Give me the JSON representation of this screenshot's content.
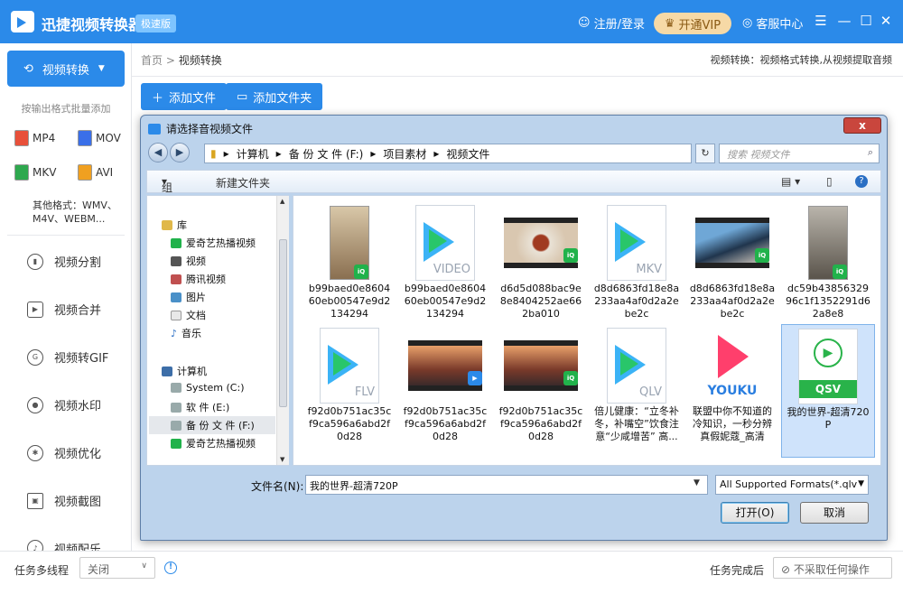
{
  "app": {
    "title": "迅捷视频转换器",
    "edition": "极速版",
    "login": "注册/登录",
    "vip": "开通VIP",
    "service": "客服中心",
    "menu_icon": "☰",
    "min_icon": "—",
    "max_icon": "☐",
    "close_icon": "✕"
  },
  "sidebar": {
    "active": "视频转换",
    "hint": "按输出格式批量添加",
    "formats": [
      "MP4",
      "MOV",
      "MKV",
      "AVI"
    ],
    "other": "其他格式：WMV、M4V、WEBM...",
    "items": [
      {
        "label": "视频分割",
        "icon": "split-icon"
      },
      {
        "label": "视频合并",
        "icon": "merge-icon"
      },
      {
        "label": "视频转GIF",
        "icon": "gif-icon"
      },
      {
        "label": "视频水印",
        "icon": "watermark-icon"
      },
      {
        "label": "视频优化",
        "icon": "optimize-icon"
      },
      {
        "label": "视频截图",
        "icon": "screenshot-icon"
      },
      {
        "label": "视频配乐",
        "icon": "music-icon"
      }
    ]
  },
  "main": {
    "breadcrumb_home": "首页",
    "breadcrumb_sep": ">",
    "breadcrumb_current": "视频转换",
    "hint": "视频转换：视频格式转换,从视频提取音频",
    "add_file": "添加文件",
    "add_folder": "添加文件夹"
  },
  "status": {
    "multithread_label": "任务多线程",
    "multithread_value": "关闭",
    "after_label": "任务完成后",
    "after_value": "不采取任何操作"
  },
  "dialog": {
    "title": "请选择音视频文件",
    "close": "x",
    "path": [
      "计算机",
      "备 份 文 件 (F:)",
      "项目素材",
      "视频文件"
    ],
    "search_placeholder": "搜索 视频文件",
    "organize": "组织",
    "new_folder": "新建文件夹",
    "tree": {
      "library": "库",
      "lib_items": [
        "爱奇艺热播视频",
        "视频",
        "腾讯视频",
        "图片",
        "文档",
        "音乐"
      ],
      "computer": "计算机",
      "drives": [
        "System (C:)",
        "软 件 (E:)",
        "备 份 文 件 (F:)",
        "爱奇艺热播视频"
      ]
    },
    "files": [
      {
        "name": "b99baed0e860460eb00547e9d2134294",
        "kind": "phone-video"
      },
      {
        "name": "b99baed0e860460eb00547e9d2134294",
        "kind": "doc",
        "ext": "VIDEO"
      },
      {
        "name": "d6d5d088bac9e8e8404252ae662ba010",
        "kind": "film"
      },
      {
        "name": "d8d6863fd18e8a233aa4af0d2a2ebe2c",
        "kind": "doc",
        "ext": "MKV"
      },
      {
        "name": "d8d6863fd18e8a233aa4af0d2a2ebe2c",
        "kind": "film"
      },
      {
        "name": "dc59b4385632996c1f1352291d62a8e8",
        "kind": "phone-video"
      },
      {
        "name": "f92d0b751ac35cf9ca596a6abd2f0d28",
        "kind": "doc",
        "ext": "FLV"
      },
      {
        "name": "f92d0b751ac35cf9ca596a6abd2f0d28",
        "kind": "film"
      },
      {
        "name": "f92d0b751ac35cf9ca596a6abd2f0d28",
        "kind": "film"
      },
      {
        "name": "倍儿健康：“立冬补冬，补嘴空”饮食注意“少咸增苦” 高...",
        "kind": "doc",
        "ext": "QLV"
      },
      {
        "name": "联盟中你不知道的冷知识，一秒分辨真假妮蔻_高清",
        "kind": "youku",
        "ext": "YOUKU"
      },
      {
        "name": "我的世界-超清720P",
        "kind": "qsv",
        "ext": "QSV",
        "selected": true
      }
    ],
    "filename_label": "文件名(N):",
    "filename_value": "我的世界-超清720P",
    "format_value": "All Supported Formats(*.qlv;",
    "open": "打开(O)",
    "cancel": "取消"
  },
  "colors": {
    "accent": "#2b8ae9",
    "vip": "#f6d9a6",
    "dialog": "#bcd3ec"
  }
}
